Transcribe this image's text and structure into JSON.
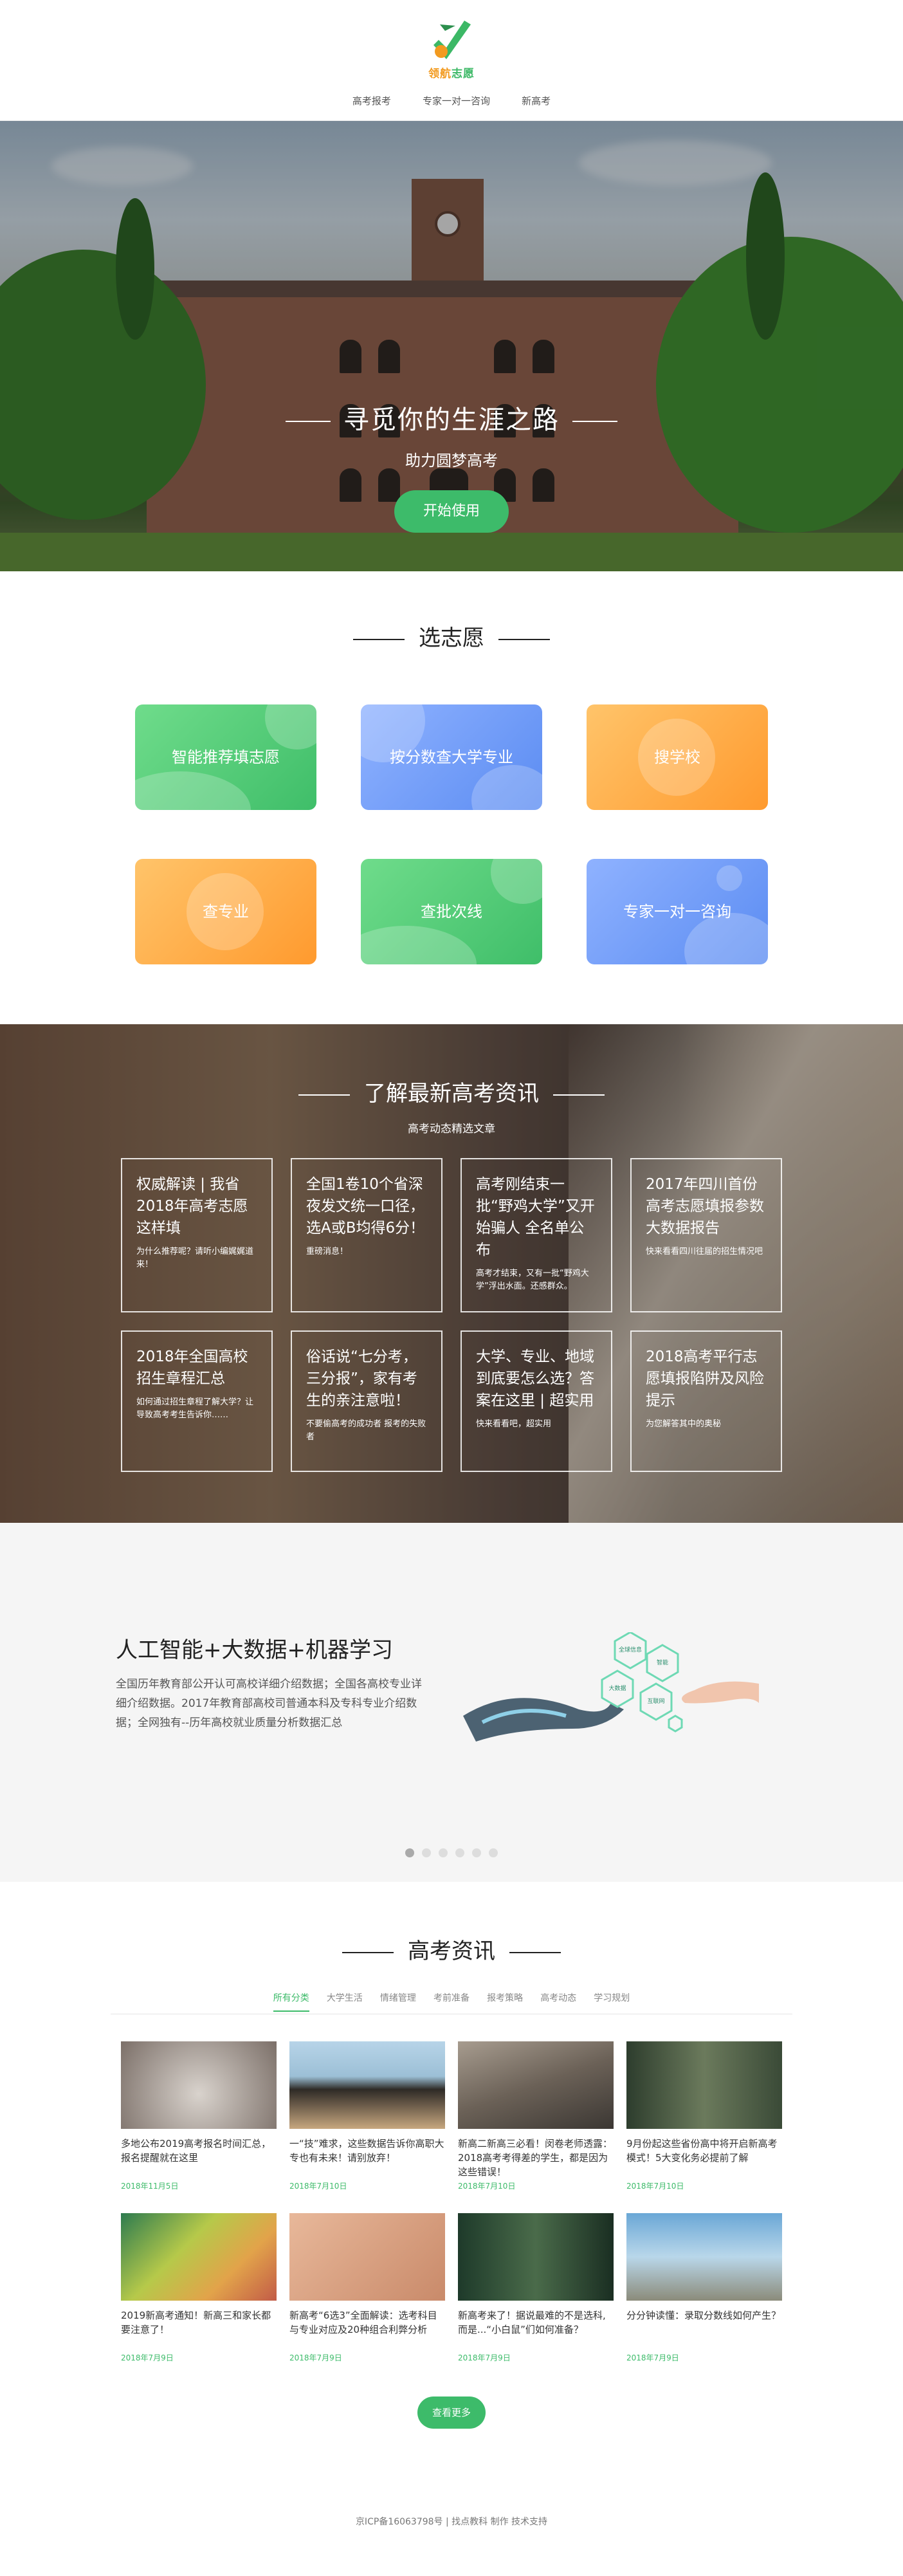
{
  "header": {
    "logo_text_a": "领航",
    "logo_text_b": "志愿",
    "nav": [
      "高考报考",
      "专家一对一咨询",
      "新高考"
    ]
  },
  "hero": {
    "title": "寻觅你的生涯之路",
    "subtitle": "助力圆梦高考",
    "button": "开始使用"
  },
  "volunteer": {
    "title": "选志愿",
    "cards": [
      "智能推荐填志愿",
      "按分数查大学专业",
      "搜学校",
      "查专业",
      "查批次线",
      "专家一对一咨询"
    ]
  },
  "news": {
    "title": "了解最新高考资讯",
    "subtitle": "高考动态精选文章",
    "items": [
      {
        "title": "权威解读 | 我省2018年高考志愿这样填",
        "desc": "为什么推荐呢？请听小编娓娓道来！"
      },
      {
        "title": "全国1卷10个省深夜发文统一口径，选A或B均得6分！",
        "desc": "重磅消息！"
      },
      {
        "title": "高考刚结束一批“野鸡大学”又开始骗人 全名单公布",
        "desc": "高考才结束，又有一批“野鸡大学”浮出水面。还感群众。"
      },
      {
        "title": "2017年四川首份高考志愿填报参数大数据报告",
        "desc": "快来看看四川往届的招生情况吧"
      },
      {
        "title": "2018年全国高校招生章程汇总",
        "desc": "如何通过招生章程了解大学？让导致高考考生告诉你……"
      },
      {
        "title": "俗话说“七分考，三分报”，家有考生的亲注意啦！",
        "desc": "不要偷高考的成功者 报考的失败者"
      },
      {
        "title": "大学、专业、地域到底要怎么选？答案在这里 | 超实用",
        "desc": "快来看看吧，超实用"
      },
      {
        "title": "2018高考平行志愿填报陷阱及风险提示",
        "desc": "为您解答其中的奥秘"
      }
    ]
  },
  "ai": {
    "title": "人工智能+大数据+机器学习",
    "desc": "全国历年教育部公开认可高校详细介绍数据；全国各高校专业详细介绍数据。2017年教育部高校司普通本科及专科专业介绍数据；全网独有--历年高校就业质量分析数据汇总",
    "hex_labels": [
      "全球信息",
      "智能",
      "大数据",
      "互联网"
    ]
  },
  "articles": {
    "title": "高考资讯",
    "tabs": [
      "所有分类",
      "大学生活",
      "情绪管理",
      "考前准备",
      "报考策略",
      "高考动态",
      "学习规划"
    ],
    "items": [
      {
        "title": "多地公布2019高考报名时间汇总，报名提醒就在这里",
        "date": "2018年11月5日"
      },
      {
        "title": "一“技”难求，这些数据告诉你高职大专也有未来！请别放弃！",
        "date": "2018年7月10日"
      },
      {
        "title": "新高二新高三必看！闵卷老师透露：2018高考考得差的学生，都是因为这些错误！",
        "date": "2018年7月10日"
      },
      {
        "title": "9月份起这些省份高中将开启新高考模式！5大变化务必提前了解",
        "date": "2018年7月10日"
      },
      {
        "title": "2019新高考通知！新高三和家长都要注意了！",
        "date": "2018年7月9日"
      },
      {
        "title": "新高考“6选3”全面解读：选考科目与专业对应及20种组合利弊分析",
        "date": "2018年7月9日"
      },
      {
        "title": "新高考来了！据说最难的不是选科,而是...“小白鼠”们如何准备？",
        "date": "2018年7月9日"
      },
      {
        "title": "分分钟读懂：录取分数线如何产生？",
        "date": "2018年7月9日"
      }
    ],
    "more": "查看更多"
  },
  "footer": {
    "text": "京ICP备16063798号 | 找点教科 制作 技术支持"
  }
}
